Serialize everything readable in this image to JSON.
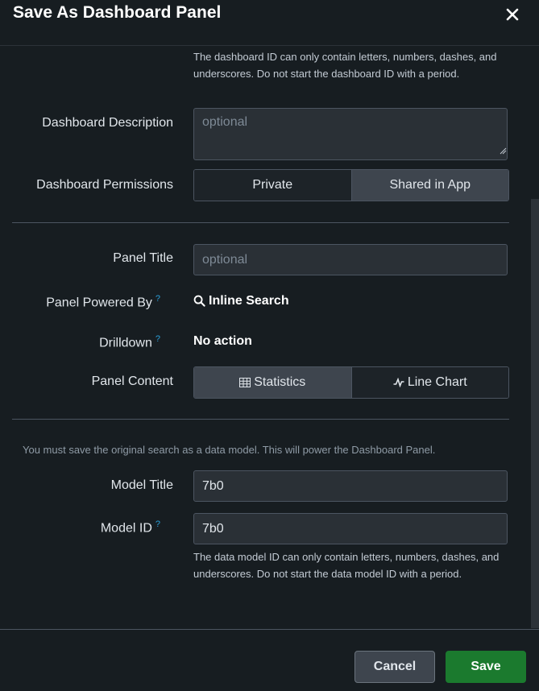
{
  "dialog": {
    "title": "Save As Dashboard Panel"
  },
  "dashboard": {
    "id_help": "The dashboard ID can only contain letters, numbers, dashes, and underscores. Do not start the dashboard ID with a period.",
    "description_label": "Dashboard Description",
    "description_placeholder": "optional",
    "permissions_label": "Dashboard Permissions",
    "permissions_options": [
      "Private",
      "Shared in App"
    ],
    "permissions_selected": "Shared in App"
  },
  "panel": {
    "title_label": "Panel Title",
    "title_placeholder": "optional",
    "powered_by_label": "Panel Powered By",
    "powered_by_value": "Inline Search",
    "drilldown_label": "Drilldown",
    "drilldown_value": "No action",
    "content_label": "Panel Content",
    "content_options": [
      "Statistics",
      "Line Chart"
    ],
    "content_selected": "Statistics",
    "help_mark": "?"
  },
  "model": {
    "note": "You must save the original search as a data model. This will power the Dashboard Panel.",
    "title_label": "Model Title",
    "title_value": "7b0",
    "id_label": "Model ID",
    "id_value": "7b0",
    "id_help": "The data model ID can only contain letters, numbers, dashes, and underscores. Do not start the data model ID with a period."
  },
  "footer": {
    "cancel_label": "Cancel",
    "save_label": "Save"
  },
  "colors": {
    "background": "#171d21",
    "field": "#2a3036",
    "active_segment": "#3e454e",
    "save_button": "#1b7a2e",
    "help_icon": "#2a9fd8"
  }
}
